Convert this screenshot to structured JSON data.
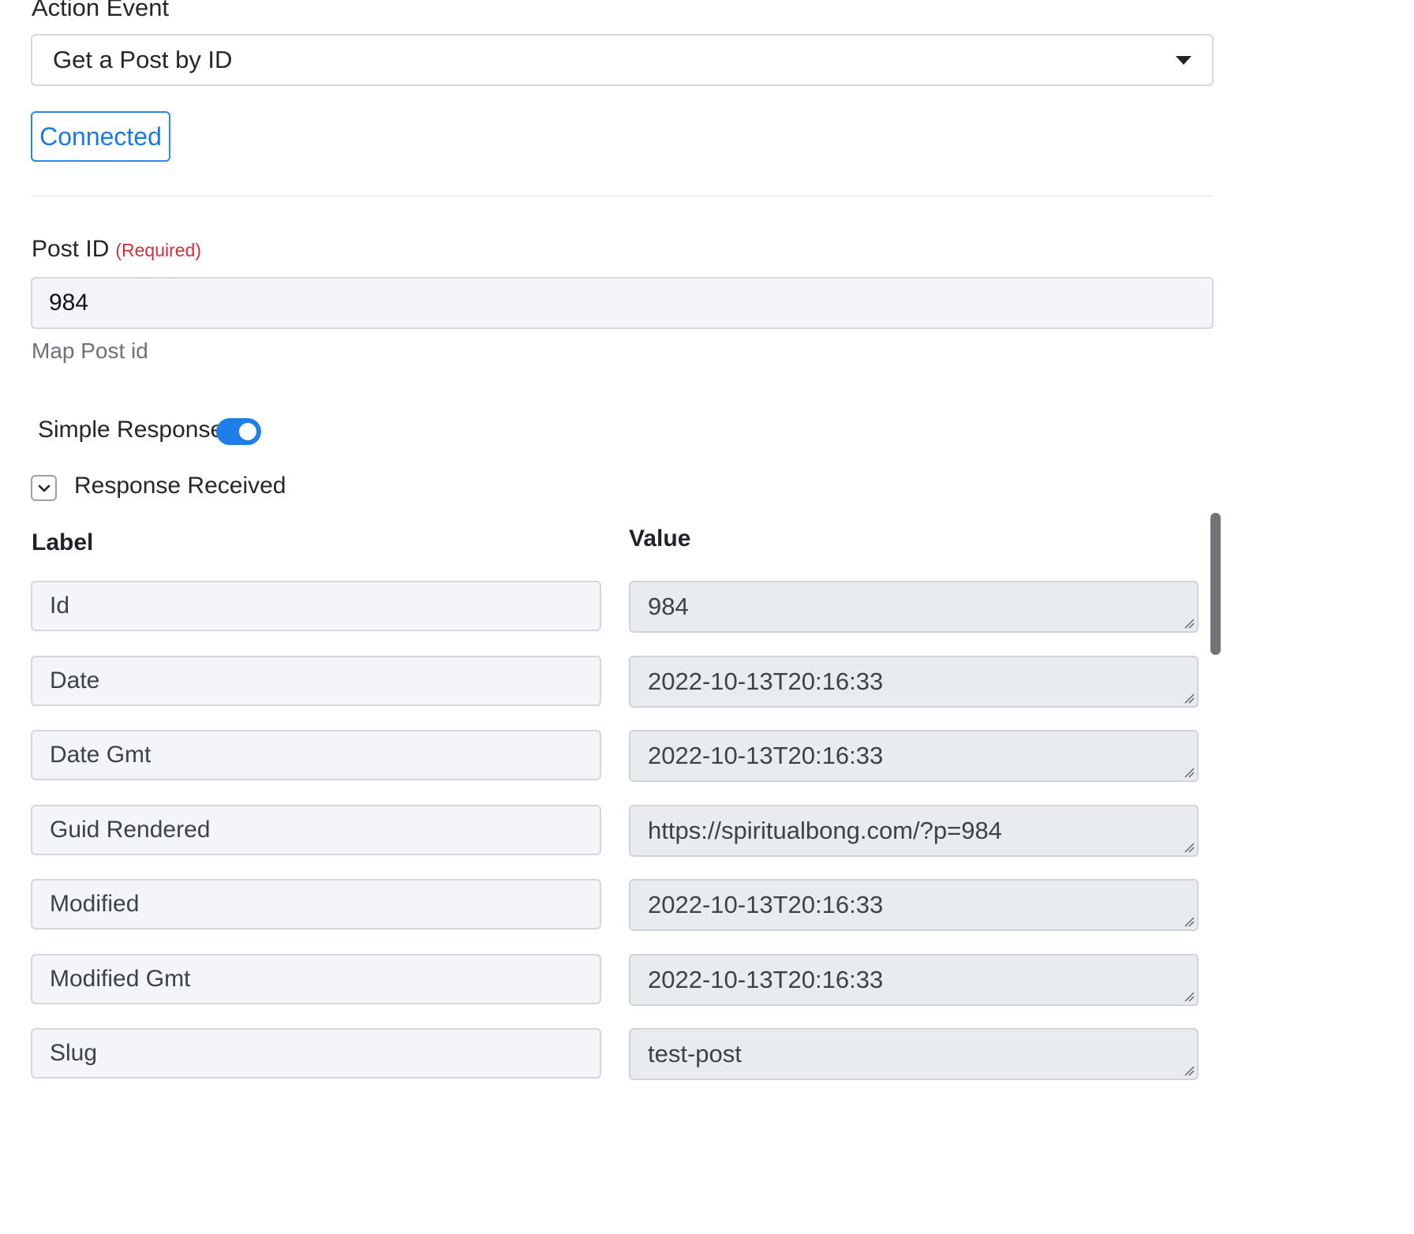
{
  "action_event": {
    "label": "Action Event",
    "selected": "Get a Post by ID",
    "caret_icon": "caret-down-icon"
  },
  "connection": {
    "status_label": "Connected",
    "color": "#1d7ae0"
  },
  "post_id": {
    "label": "Post ID",
    "required_text": "(Required)",
    "value": "984",
    "help": "Map Post id"
  },
  "simple_response": {
    "label": "Simple Response",
    "enabled": true,
    "toggle_color": "#1f7ee8"
  },
  "response": {
    "label": "Response Received",
    "expand_icon": "chevron-down-icon",
    "columns": {
      "label": "Label",
      "value": "Value"
    },
    "rows": [
      {
        "label": "Id",
        "value": "984"
      },
      {
        "label": "Date",
        "value": "2022-10-13T20:16:33"
      },
      {
        "label": "Date Gmt",
        "value": "2022-10-13T20:16:33"
      },
      {
        "label": "Guid Rendered",
        "value": "https://spiritualbong.com/?p=984"
      },
      {
        "label": "Modified",
        "value": "2022-10-13T20:16:33"
      },
      {
        "label": "Modified Gmt",
        "value": "2022-10-13T20:16:33"
      },
      {
        "label": "Slug",
        "value": "test-post"
      }
    ]
  }
}
